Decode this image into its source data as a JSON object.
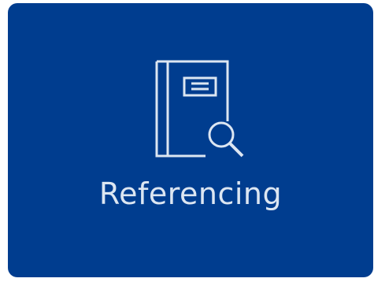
{
  "tile": {
    "label": "Referencing",
    "icon": "book-search-icon",
    "background_color": "#003d8f",
    "foreground_color": "#dce6f2"
  }
}
